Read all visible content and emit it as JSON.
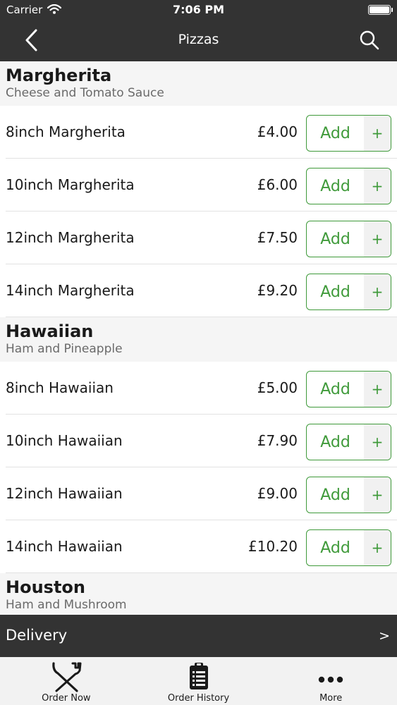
{
  "status": {
    "carrier": "Carrier",
    "time": "7:06 PM"
  },
  "nav": {
    "title": "Pizzas"
  },
  "sections": [
    {
      "title": "Margherita",
      "description": "Cheese and Tomato Sauce",
      "items": [
        {
          "name": "8inch Margherita",
          "price": "£4.00"
        },
        {
          "name": "10inch Margherita",
          "price": "£6.00"
        },
        {
          "name": "12inch Margherita",
          "price": "£7.50"
        },
        {
          "name": "14inch Margherita",
          "price": "£9.20"
        }
      ]
    },
    {
      "title": "Hawaiian",
      "description": "Ham and Pineapple",
      "items": [
        {
          "name": "8inch Hawaiian",
          "price": "£5.00"
        },
        {
          "name": "10inch Hawaiian",
          "price": "£7.90"
        },
        {
          "name": "12inch Hawaiian",
          "price": "£9.00"
        },
        {
          "name": "14inch Hawaiian",
          "price": "£10.20"
        }
      ]
    },
    {
      "title": "Houston",
      "description": "Ham and Mushroom",
      "items": []
    }
  ],
  "buttons": {
    "add_label": "Add",
    "plus": "+"
  },
  "delivery": {
    "label": "Delivery",
    "arrow": ">"
  },
  "tabs": [
    {
      "label": "Order Now",
      "icon": "fork-knife-icon"
    },
    {
      "label": "Order History",
      "icon": "clipboard-icon"
    },
    {
      "label": "More",
      "icon": "more-dots-icon"
    }
  ],
  "colors": {
    "bar": "#333333",
    "accent": "#3f9a3a",
    "section_bg": "#f5f5f5"
  }
}
